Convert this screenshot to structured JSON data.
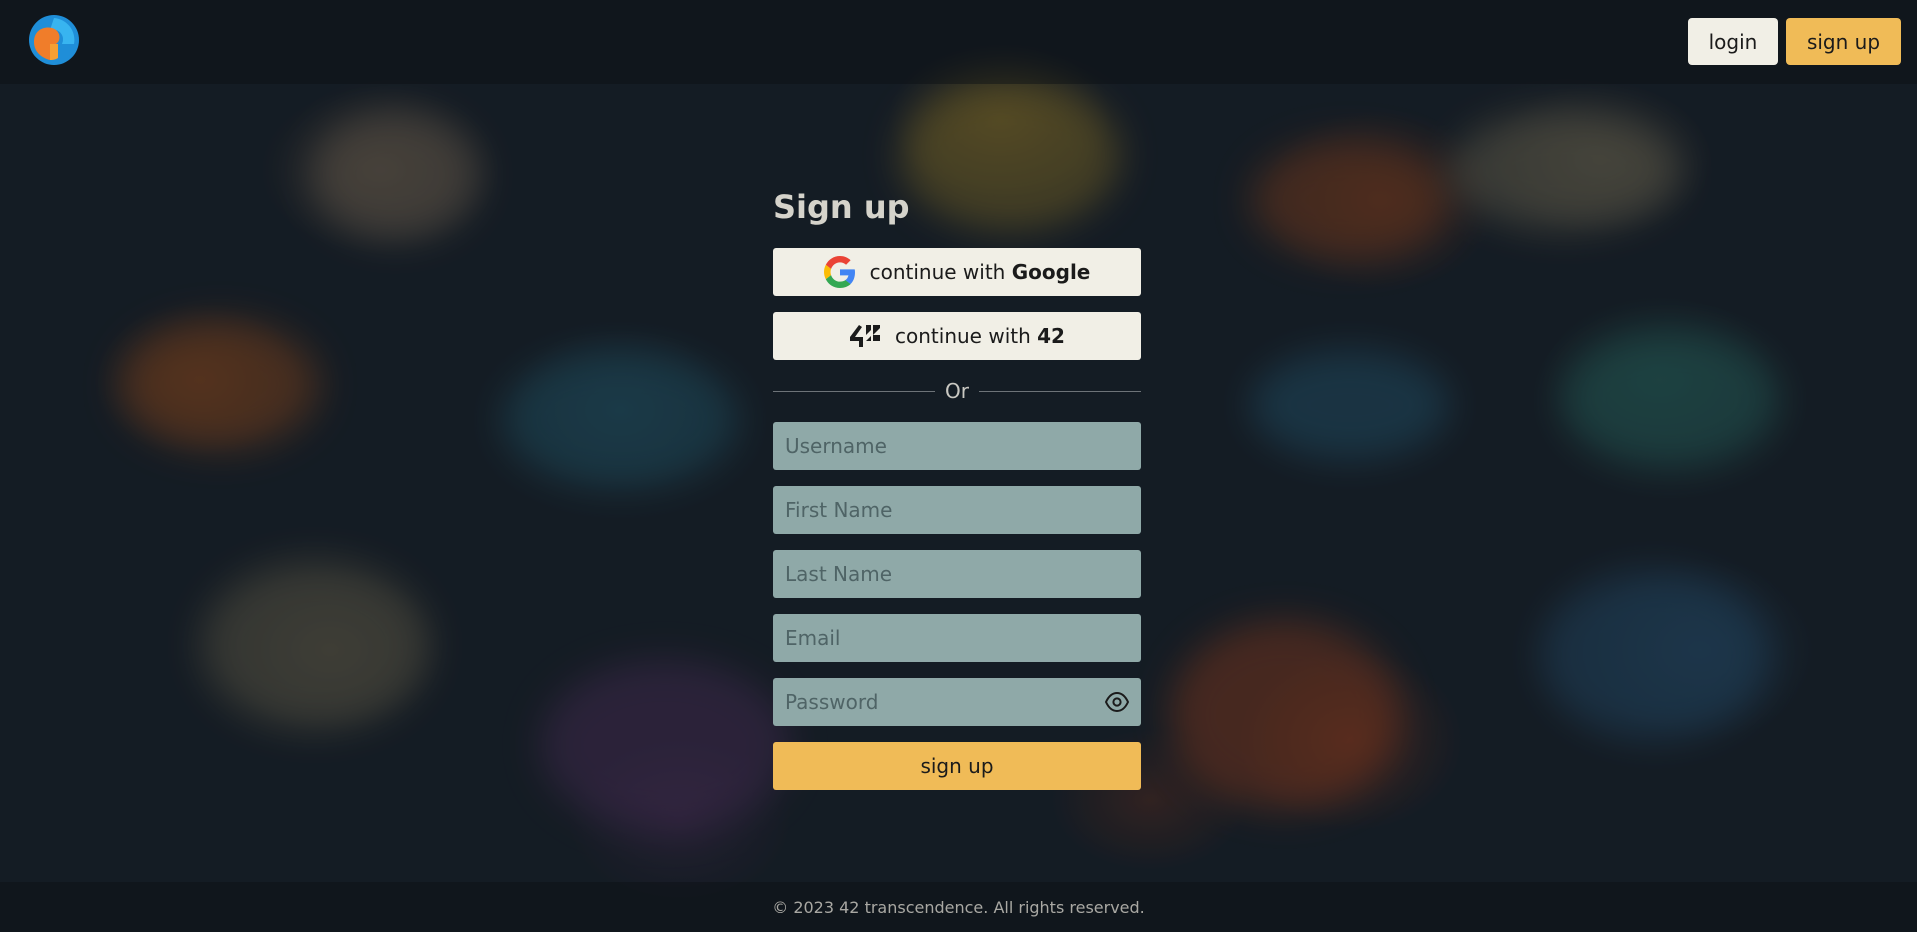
{
  "colors": {
    "accent": "#f0bb57",
    "light_button": "#f1efe6",
    "input_background": "#8fa9a8",
    "title_text": "#d5d3cb"
  },
  "header": {
    "logo_icon": "app-logo-icon",
    "login_label": "login",
    "signup_label": "sign up"
  },
  "form": {
    "title": "Sign up",
    "google": {
      "icon": "google-icon",
      "prefix": "continue with",
      "brand": "Google"
    },
    "fortytwo": {
      "icon": "42-logo-icon",
      "prefix": "continue with",
      "brand": "42"
    },
    "divider_text": "Or",
    "fields": {
      "username_placeholder": "Username",
      "first_name_placeholder": "First Name",
      "last_name_placeholder": "Last Name",
      "email_placeholder": "Email",
      "password_placeholder": "Password",
      "password_toggle_icon": "eye-icon"
    },
    "submit_label": "sign up"
  },
  "footer": {
    "copyright": "© 2023 42 transcendence. All rights reserved."
  }
}
